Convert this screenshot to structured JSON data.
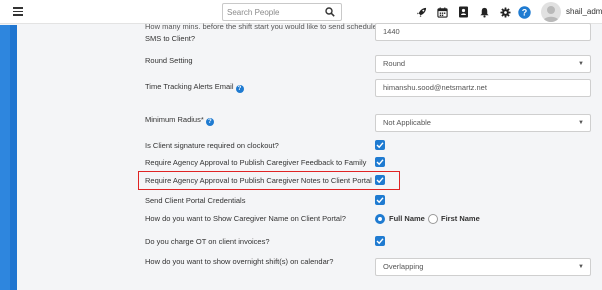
{
  "topbar": {
    "search": {
      "placeholder": "Search People",
      "value": ""
    },
    "icons": [
      "rocket-icon",
      "calendar-icon",
      "contacts-book-icon",
      "bell-icon",
      "gear-icon",
      "help-icon"
    ],
    "username": "shail_admin"
  },
  "settings": {
    "row0": {
      "label_line1": "How many mins. before the shift start you would like to send schedule",
      "label_line2": "SMS to Client?",
      "value": "1440"
    },
    "round_setting": {
      "label": "Round Setting",
      "value": "Round"
    },
    "time_tracking_email": {
      "label": "Time Tracking Alerts Email",
      "value": "himanshu.sood@netsmartz.net"
    },
    "minimum_radius": {
      "label": "Minimum Radius*",
      "value": "Not Applicable"
    },
    "client_signature": {
      "label": "Is Client signature required on clockout?",
      "checked": true
    },
    "approval_feedback": {
      "label": "Require Agency Approval to Publish Caregiver Feedback to Family",
      "checked": true
    },
    "approval_notes": {
      "label": "Require Agency Approval to Publish Caregiver Notes to Client Portal",
      "checked": true
    },
    "portal_credentials": {
      "label": "Send Client Portal Credentials",
      "checked": true
    },
    "caregiver_name": {
      "label": "How do you want to Show Caregiver Name on Client Portal?",
      "options": [
        "Full Name",
        "First Name"
      ],
      "selected": "Full Name"
    },
    "charge_ot": {
      "label": "Do you charge OT on client invoices?",
      "checked": true
    },
    "overnight": {
      "label": "How do you want to show overnight shift(s) on calendar?",
      "value": "Overlapping"
    }
  },
  "colors": {
    "accent": "#1f7bd1",
    "highlight": "#e02424",
    "sidebar": "#2e86de"
  }
}
